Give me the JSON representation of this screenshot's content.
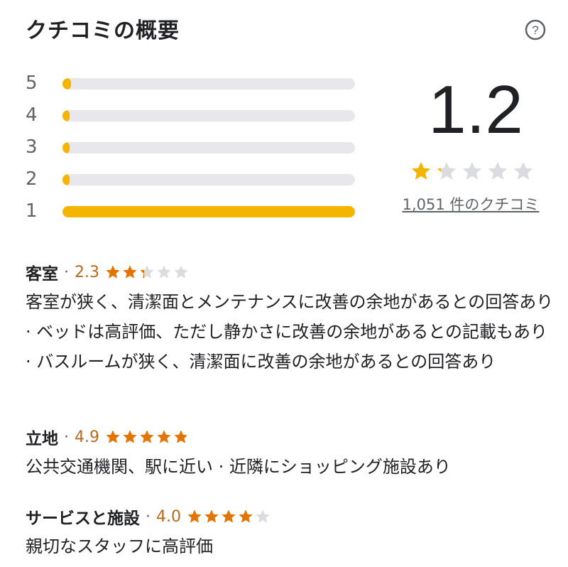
{
  "header": {
    "title": "クチコミの概要"
  },
  "histogram": [
    {
      "label": "5",
      "fraction": 0.03
    },
    {
      "label": "4",
      "fraction": 0.025
    },
    {
      "label": "3",
      "fraction": 0.02
    },
    {
      "label": "2",
      "fraction": 0.01
    },
    {
      "label": "1",
      "fraction": 1.0
    }
  ],
  "overall": {
    "score": "1.2",
    "rating": 1.2,
    "review_count_label": "1,051 件のクチコミ"
  },
  "sections": [
    {
      "title": "客室",
      "score_text": "2.3",
      "rating": 2.3,
      "body": "客室が狭く、清潔面とメンテナンスに改善の余地があるとの回答あり · ベッドは高評価、ただし静かさに改善の余地があるとの記載もあり · バスルームが狭く、清潔面に改善の余地があるとの回答あり"
    },
    {
      "title": "立地",
      "score_text": "4.9",
      "rating": 4.9,
      "body": "公共交通機関、駅に近い · 近隣にショッピング施設あり"
    },
    {
      "title": "サービスと施設",
      "score_text": "4.0",
      "rating": 4.0,
      "body": "親切なスタッフに高評価"
    }
  ],
  "colors": {
    "bar_fill": "#f4b400",
    "bar_track": "#e8e8ec",
    "star_filled_overall": "#f4b400",
    "star_filled_section": "#e37400",
    "star_empty": "#dadce0"
  },
  "icons": {
    "help": "question-circle-icon",
    "star": "star-icon"
  }
}
